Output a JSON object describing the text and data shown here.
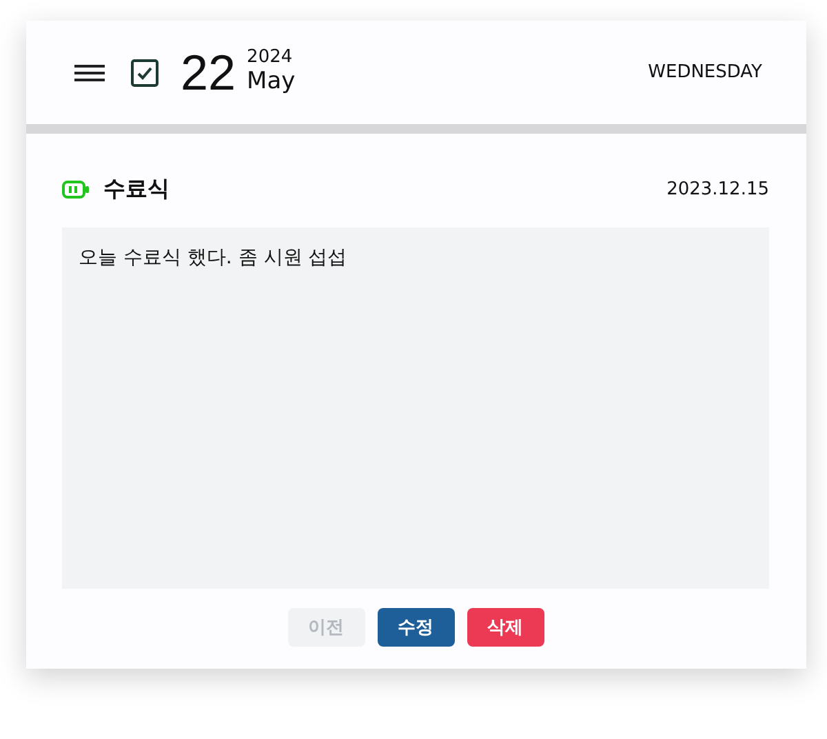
{
  "header": {
    "day": "22",
    "year": "2024",
    "month": "May",
    "weekday": "WEDNESDAY",
    "checked": true
  },
  "entry": {
    "title": "수료식",
    "date": "2023.12.15",
    "body": "오늘 수료식 했다. 좀 시원 섭섭"
  },
  "buttons": [
    {
      "label": "이전",
      "kind": "secondary",
      "disabled": true
    },
    {
      "label": "수정",
      "kind": "primary",
      "disabled": false
    },
    {
      "label": "삭제",
      "kind": "danger",
      "disabled": false
    }
  ]
}
